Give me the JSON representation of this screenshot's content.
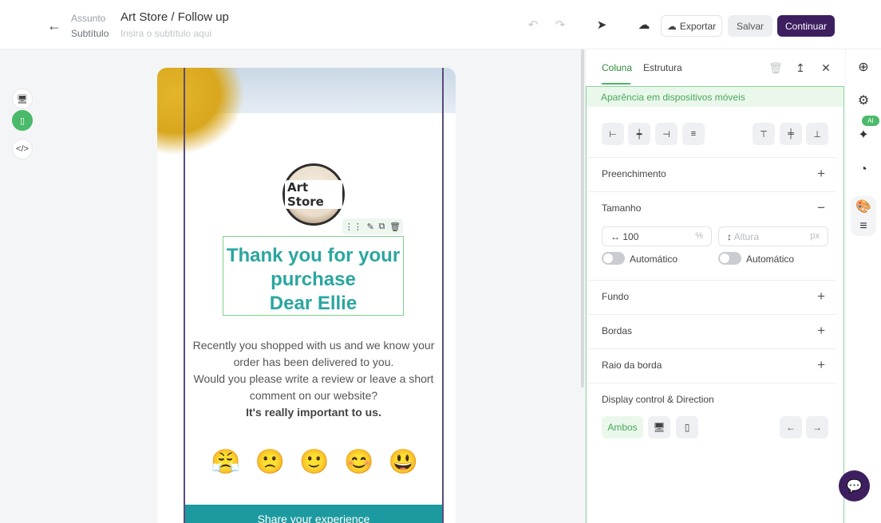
{
  "header": {
    "subject_label": "Assunto",
    "subtitle_label": "Subtítulo",
    "subject_value": "Art Store / Follow up",
    "subtitle_placeholder": "Insira o subtítulo aqui",
    "export_label": "Exportar",
    "save_label": "Salvar",
    "continue_label": "Continuar"
  },
  "email": {
    "logo_text": "Art Store",
    "heading_line1": "Thank you for your",
    "heading_line2": "purchase",
    "heading_line3": "Dear Ellie",
    "body_line1": "Recently you shopped with us and we know your order has been delivered to you.",
    "body_line2": "Would you please write a review or leave a short comment on our website?",
    "body_bold": "It's really important to us.",
    "emojis": [
      "😤",
      "🙁",
      "🙂",
      "😊",
      "😃"
    ],
    "cta_label": "Share your experience"
  },
  "panel": {
    "tab_column": "Coluna",
    "tab_structure": "Estrutura",
    "mobile_banner": "Aparência em dispositivos móveis",
    "sections": {
      "fill": "Preenchimento",
      "size": "Tamanho",
      "background": "Fundo",
      "borders": "Bordas",
      "radius": "Raio da borda",
      "display": "Display control & Direction"
    },
    "width_value": "100",
    "width_unit": "%",
    "height_placeholder": "Altura",
    "height_unit": "px",
    "auto_label": "Automático",
    "both_label": "Ambos"
  },
  "rail": {
    "ai_badge": "AI"
  },
  "colors": {
    "brand_primary": "#3d1f5f",
    "accent_green": "#4bb96a",
    "heading_teal": "#2aa6a0",
    "cta_teal": "#1d9aa0"
  }
}
